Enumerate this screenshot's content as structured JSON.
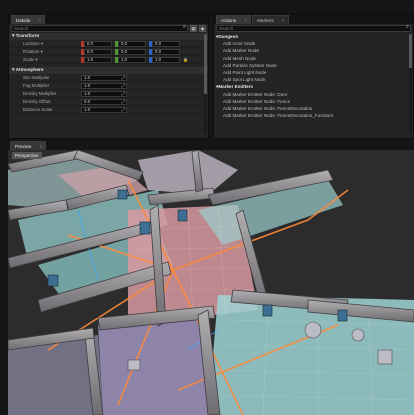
{
  "details_panel": {
    "tab": "Details",
    "search_placeholder": "Search",
    "transform": {
      "title": "Transform",
      "location": {
        "label": "Location",
        "x": "0.0",
        "y": "0.0",
        "z": "0.0"
      },
      "rotation": {
        "label": "Rotation",
        "x": "0.0",
        "y": "0.0",
        "z": "0.0"
      },
      "scale": {
        "label": "Scale",
        "x": "1.0",
        "y": "1.0",
        "z": "1.0"
      }
    },
    "atmosphere": {
      "title": "Atmosphere",
      "rows": [
        {
          "label": "Sun Multiplier",
          "value": "1.0"
        },
        {
          "label": "Fog Multiplier",
          "value": "1.0"
        },
        {
          "label": "Density Multiplier",
          "value": "1.0"
        },
        {
          "label": "Density Offset",
          "value": "0.0"
        },
        {
          "label": "Distance Scale",
          "value": "1.0"
        }
      ]
    }
  },
  "actions_panel": {
    "tabs": [
      "Actions",
      "Markers"
    ],
    "search_placeholder": "Search",
    "categories": [
      {
        "title": "Dungeon",
        "items": [
          "Add Actor Node",
          "Add Marker Node",
          "Add Mesh Node",
          "Add Particle System Node",
          "Add Point Light Node",
          "Add Spot Light Node"
        ]
      },
      {
        "title": "Marker Emitters",
        "items": [
          "Add Marker Emitter Node: Door",
          "Add Marker Emitter Node: Fence",
          "Add Marker Emitter Node: FenceDecoration",
          "Add Marker Emitter Node: FenceDecoration_Furniture"
        ]
      }
    ]
  },
  "viewport": {
    "tab": "Preview",
    "label": "Perspective"
  }
}
